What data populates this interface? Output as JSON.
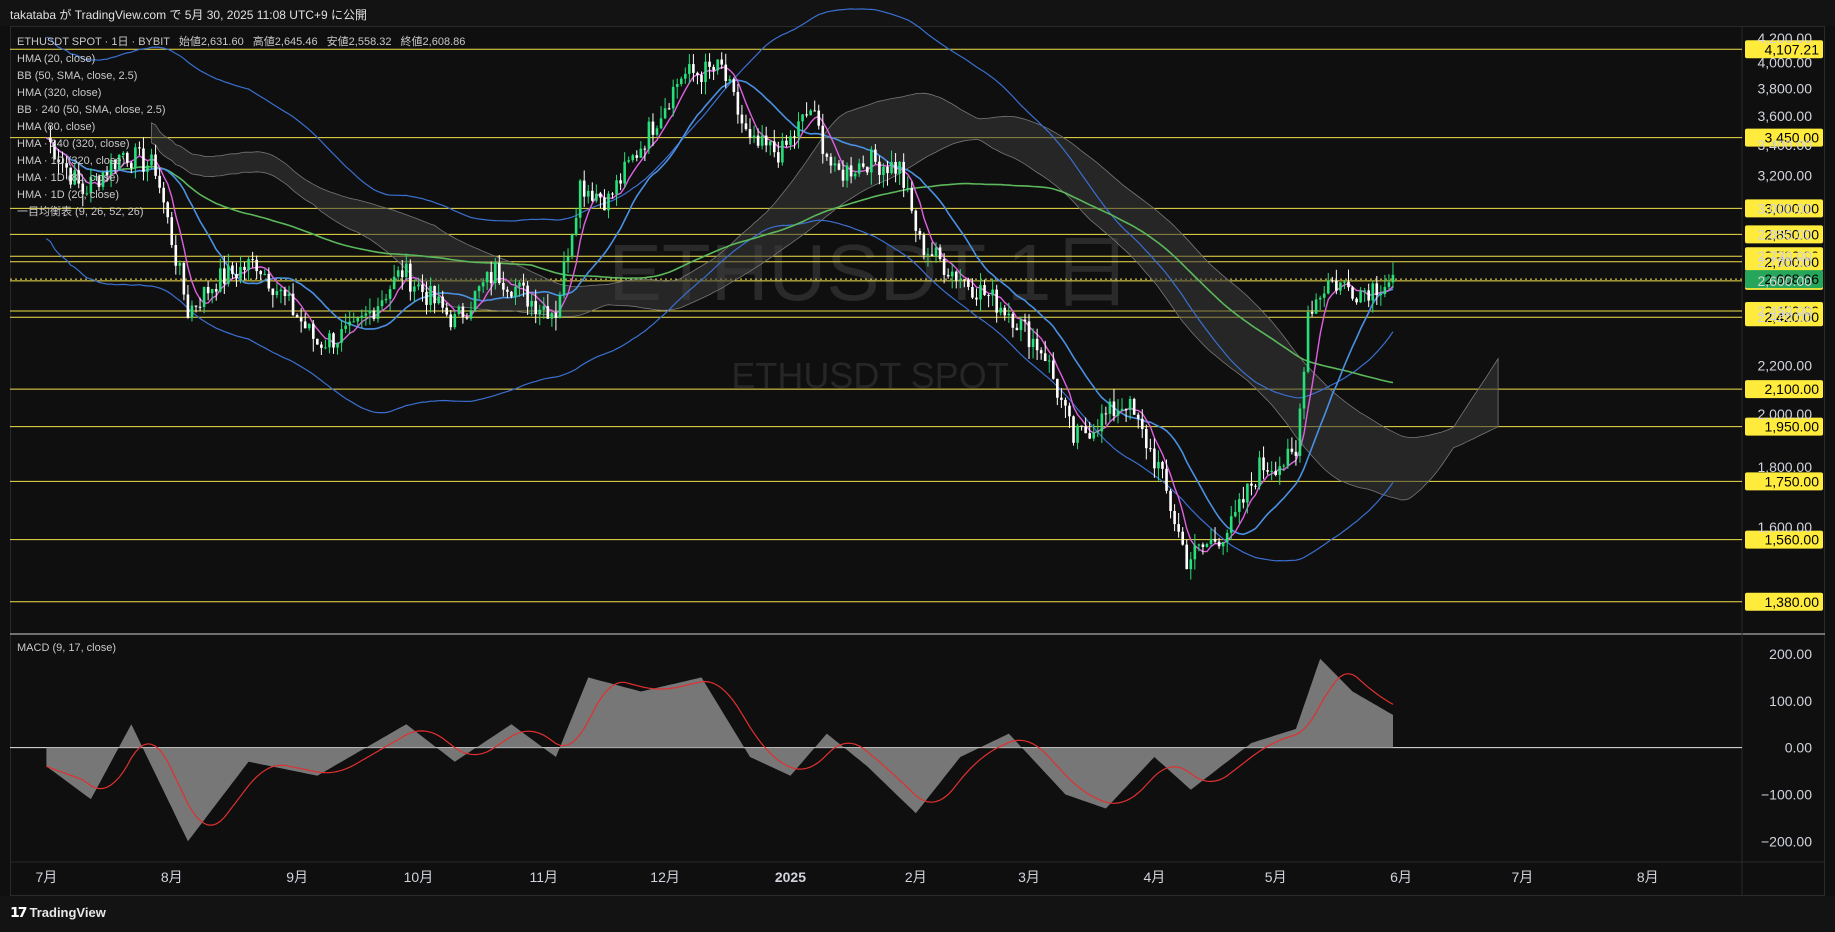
{
  "publish_line": "takataba が TradingView.com で 5月 30, 2025 11:08 UTC+9 に公開",
  "brand": "TradingView",
  "watermark": {
    "main": "ETHUSDT 1日",
    "sub": "ETHUSDT SPOT"
  },
  "symbol_line": {
    "symbol": "ETHUSDT SPOT · 1日 · BYBIT",
    "open_label": "始値",
    "open": "2,631.60",
    "high_label": "高値",
    "high": "2,645.46",
    "low_label": "安値",
    "low": "2,558.32",
    "close_label": "終値",
    "close": "2,608.86"
  },
  "indicators": [
    "HMA (20, close)",
    "BB (50, SMA, close, 2.5)",
    "HMA (320, close)",
    "BB · 240 (50, SMA, close, 2.5)",
    "HMA (80, close)",
    "HMA · 240 (320, close)",
    "HMA · 1D (320, close)",
    "HMA · 1D (80, close)",
    "HMA · 1D (20, close)",
    "一目均衡表 (9, 26, 52, 26)"
  ],
  "macd_label": "MACD (9, 17, close)",
  "colors": {
    "up": "#26e07a",
    "down": "#ffffff",
    "hma20": "#e060e0",
    "hma80": "#4a90e2",
    "hma320": "#5cb85c",
    "bb": "#3a6fd0",
    "hline": "#f2e04a",
    "label_bg": "#ffeb3b",
    "current_bg": "#26a65b",
    "macd_hist": "#8a8a8a",
    "macd_signal": "#e03030"
  },
  "chart_data": {
    "type": "line",
    "title": "ETHUSDT SPOT · 1日 · BYBIT",
    "y_scale": "log",
    "ylim": [
      1300,
      4250
    ],
    "y_ticks": [
      "4,200.00",
      "4,000.00",
      "3,800.00",
      "3,600.00",
      "3,400.00",
      "3,200.00",
      "3,000.00",
      "2,850.00",
      "2,730.00",
      "2,700.00",
      "2,600.00",
      "2,450.00",
      "2,420.00",
      "2,200.00",
      "2,000.00",
      "1,800.00",
      "1,600.00"
    ],
    "x_ticks": [
      "7月",
      "8月",
      "9月",
      "10月",
      "11月",
      "12月",
      "2025",
      "2月",
      "3月",
      "4月",
      "5月",
      "6月",
      "7月",
      "8月"
    ],
    "horizontal_levels": [
      4107.21,
      3450.0,
      3000.0,
      2850.0,
      2730.0,
      2700.0,
      2600.0,
      2450.0,
      2420.0,
      2100.0,
      1950.0,
      1750.0,
      1560.0,
      1380.0
    ],
    "horizontal_level_labels": [
      "4,107.21",
      "3,450.00",
      "3,000.00",
      "2,850.00",
      "2,730.00",
      "2,700.00",
      "2,600.00",
      "2,450.00",
      "2,420.00",
      "2,100.00",
      "1,950.00",
      "1,750.00",
      "1,560.00",
      "1,380.00"
    ],
    "current_price": 2608.86,
    "current_price_label": "2,608.86",
    "series": [
      {
        "dates": [
          "2024-07-01",
          "2024-07-10",
          "2024-07-20",
          "2024-07-28",
          "2024-08-05",
          "2024-08-12",
          "2024-08-22",
          "2024-09-06",
          "2024-09-15",
          "2024-09-27",
          "2024-10-10",
          "2024-10-20",
          "2024-10-29",
          "2024-11-04",
          "2024-11-10",
          "2024-11-17",
          "2024-11-25",
          "2024-12-05",
          "2024-12-15",
          "2024-12-22",
          "2024-12-30",
          "2025-01-06",
          "2025-01-12",
          "2025-01-20",
          "2025-01-28",
          "2025-02-02",
          "2025-02-10",
          "2025-02-24",
          "2025-03-05",
          "2025-03-12",
          "2025-03-25",
          "2025-04-02",
          "2025-04-09",
          "2025-04-20",
          "2025-04-27",
          "2025-05-06",
          "2025-05-09",
          "2025-05-14",
          "2025-05-22",
          "2025-05-30"
        ],
        "values": [
          3450,
          3100,
          3350,
          3250,
          2450,
          2600,
          2700,
          2300,
          2350,
          2650,
          2400,
          2650,
          2500,
          2450,
          3150,
          3050,
          3400,
          3900,
          3950,
          3400,
          3350,
          3650,
          3200,
          3300,
          3250,
          2800,
          2650,
          2450,
          2250,
          1900,
          2050,
          1800,
          1500,
          1600,
          1800,
          1830,
          2450,
          2600,
          2550,
          2608.86
        ]
      },
      {
        "name": "MACD (9, 17, close)",
        "dates": [
          "2024-07-01",
          "2024-07-12",
          "2024-07-22",
          "2024-08-05",
          "2024-08-20",
          "2024-09-06",
          "2024-09-28",
          "2024-10-10",
          "2024-10-24",
          "2024-11-04",
          "2024-11-12",
          "2024-11-25",
          "2024-12-10",
          "2024-12-22",
          "2025-01-01",
          "2025-01-10",
          "2025-01-20",
          "2025-02-01",
          "2025-02-12",
          "2025-02-24",
          "2025-03-10",
          "2025-03-20",
          "2025-04-01",
          "2025-04-10",
          "2025-04-25",
          "2025-05-06",
          "2025-05-12",
          "2025-05-20",
          "2025-05-30"
        ],
        "values": [
          -40,
          -110,
          50,
          -200,
          -30,
          -60,
          50,
          -30,
          50,
          -20,
          150,
          120,
          150,
          -20,
          -60,
          30,
          -40,
          -140,
          -20,
          30,
          -100,
          -130,
          -20,
          -90,
          10,
          40,
          190,
          120,
          70
        ]
      }
    ],
    "macd_ylim": [
      -240,
      230
    ],
    "macd_ticks": [
      "200.00",
      "100.00",
      "0.00",
      "−100.00",
      "−200.00"
    ]
  }
}
